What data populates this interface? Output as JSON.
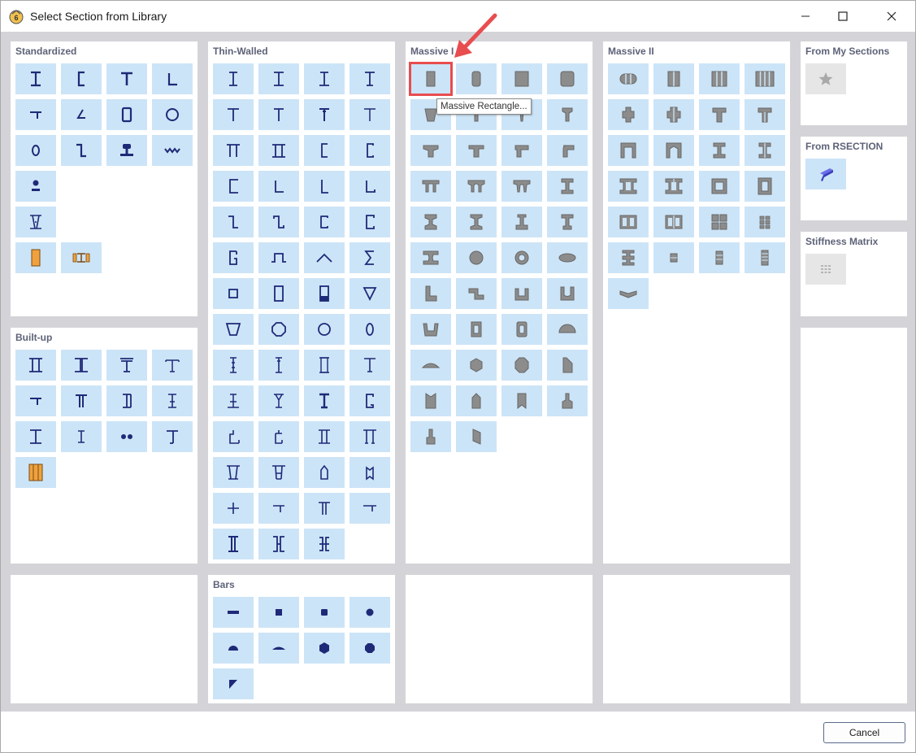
{
  "window": {
    "title": "Select Section from Library"
  },
  "icons": {
    "app": "app-logo-icon",
    "minimize": "minimize-icon",
    "maximize": "maximize-icon",
    "close": "close-icon"
  },
  "colors": {
    "tile_bg": "#cce4f7",
    "steel_glyph": "#1e2a78",
    "massive_glyph": "#8c8c8c",
    "highlight": "#e84d4f",
    "panel_title": "#5d6278"
  },
  "panels": {
    "standardized": "Standardized",
    "thin_walled": "Thin-Walled",
    "massive_i": "Massive I",
    "massive_ii": "Massive II",
    "from_my_sections": "From My Sections",
    "from_rsection": "From RSECTION",
    "stiffness_matrix": "Stiffness Matrix",
    "built_up": "Built-up",
    "bars": "Bars"
  },
  "tooltip": "Massive Rectangle...",
  "buttons": {
    "cancel": "Cancel"
  }
}
